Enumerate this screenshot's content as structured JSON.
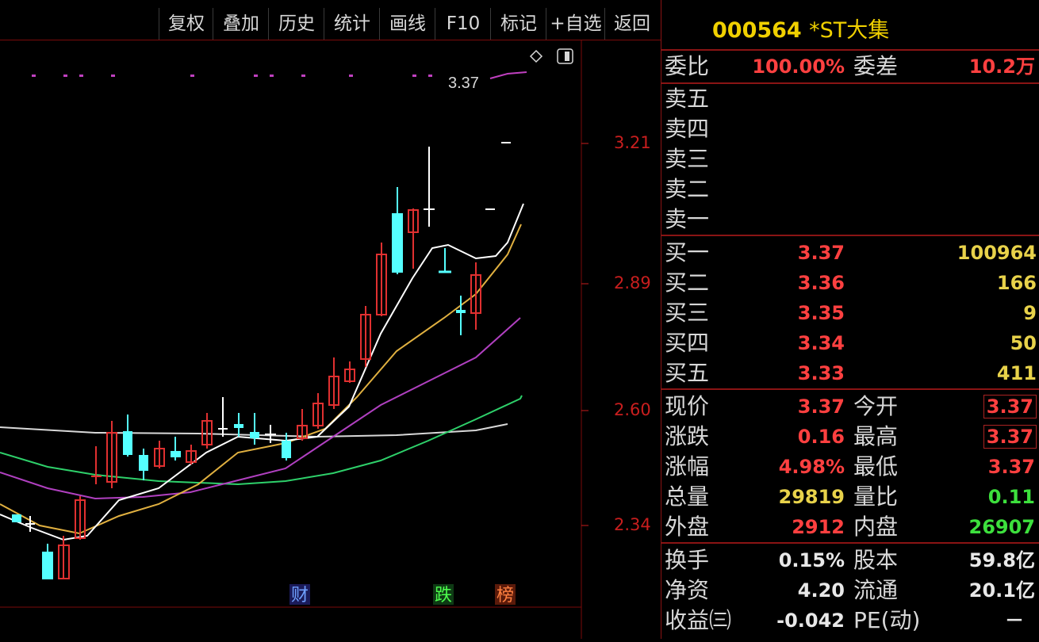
{
  "toolbar": {
    "items": [
      "复权",
      "叠加",
      "历史",
      "统计",
      "画线",
      "F10",
      "标记",
      "+自选",
      "返回"
    ]
  },
  "chart": {
    "last_price_tag": "3.37",
    "price_labels": [
      "3.21",
      "2.89",
      "2.60",
      "2.34"
    ],
    "markers": [
      "财",
      "跌",
      "榜"
    ],
    "icons": [
      "diamond-icon",
      "panel-toggle-icon"
    ]
  },
  "stock": {
    "code": "000564",
    "name": "*ST大集"
  },
  "order": {
    "ratio_label": "委比",
    "ratio_value": "100.00%",
    "diff_label": "委差",
    "diff_value": "10.2万"
  },
  "sell": [
    {
      "label": "卖五"
    },
    {
      "label": "卖四"
    },
    {
      "label": "卖三"
    },
    {
      "label": "卖二"
    },
    {
      "label": "卖一"
    }
  ],
  "buy": [
    {
      "label": "买一",
      "price": "3.37",
      "volume": "100964"
    },
    {
      "label": "买二",
      "price": "3.36",
      "volume": "166"
    },
    {
      "label": "买三",
      "price": "3.35",
      "volume": "9"
    },
    {
      "label": "买四",
      "price": "3.34",
      "volume": "50"
    },
    {
      "label": "买五",
      "price": "3.33",
      "volume": "411"
    }
  ],
  "quote": [
    {
      "l1": "现价",
      "v1": "3.37",
      "l2": "今开",
      "v2": "3.37"
    },
    {
      "l1": "涨跌",
      "v1": "0.16",
      "l2": "最高",
      "v2": "3.37"
    },
    {
      "l1": "涨幅",
      "v1": "4.98%",
      "l2": "最低",
      "v2": "3.37"
    },
    {
      "l1": "总量",
      "v1": "29819",
      "l2": "量比",
      "v2": "0.11"
    },
    {
      "l1": "外盘",
      "v1": "2912",
      "l2": "内盘",
      "v2": "26907"
    }
  ],
  "fund": [
    {
      "l1": "换手",
      "v1": "0.15%",
      "l2": "股本",
      "v2": "59.8亿"
    },
    {
      "l1": "净资",
      "v1": "4.20",
      "l2": "流通",
      "v2": "20.1亿"
    },
    {
      "l1": "收益㈢",
      "v1": "-0.042",
      "l2": "PE(动)",
      "v2": "－"
    }
  ]
}
